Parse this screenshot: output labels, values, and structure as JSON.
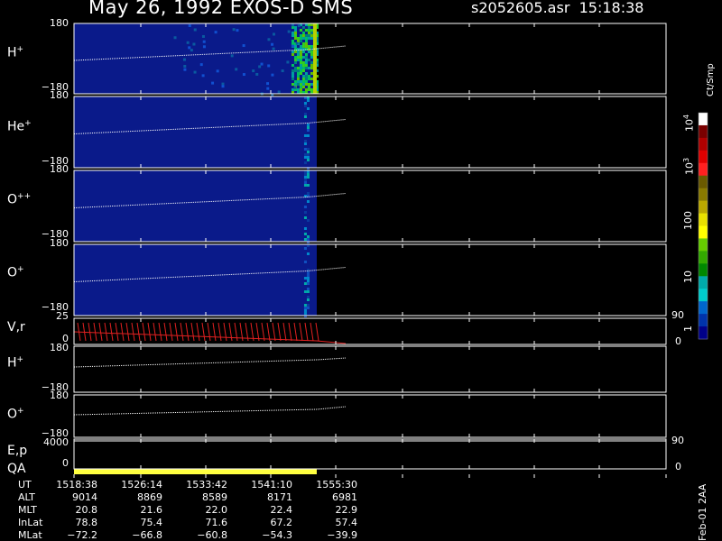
{
  "header": {
    "title": "May 26, 1992    EXOS-D SMS",
    "file": "s2052605.asr",
    "time": "15:18:38"
  },
  "panels": [
    {
      "label": "H",
      "sup": "+",
      "ticks": [
        "180",
        "−180"
      ]
    },
    {
      "label": "He",
      "sup": "+",
      "ticks": [
        "180",
        "−180"
      ]
    },
    {
      "label": "O",
      "sup": "++",
      "ticks": [
        "180",
        "−180"
      ]
    },
    {
      "label": "O",
      "sup": "+",
      "ticks": [
        "180",
        "−180"
      ]
    }
  ],
  "vr_panel": {
    "label": "V,r",
    "ticks": [
      "25",
      "0"
    ],
    "right_ticks": [
      "90",
      "0"
    ]
  },
  "lower_panels": [
    {
      "label": "H",
      "sup": "+",
      "ticks": [
        "180",
        "−180"
      ]
    },
    {
      "label": "O",
      "sup": "+",
      "ticks": [
        "180",
        "−180"
      ]
    }
  ],
  "ep_panel": {
    "label": "E,p",
    "ticks": [
      "4000",
      "0"
    ],
    "right_ticks": [
      "90",
      "0"
    ]
  },
  "qa_label": "QA",
  "colorbar": {
    "unit": "Ct/Smp",
    "labels": [
      "10",
      "10",
      "100",
      "10",
      "1"
    ],
    "exponents": [
      "4",
      "3",
      "",
      "",
      ""
    ],
    "colors": [
      "#ffffff",
      "#7a0000",
      "#b00000",
      "#e00000",
      "#ff2020",
      "#6b5a00",
      "#8a7a00",
      "#bba800",
      "#e8e000",
      "#ffff00",
      "#66cc00",
      "#33aa00",
      "#008800",
      "#00aaaa",
      "#00cccc",
      "#0066cc",
      "#0033aa",
      "#000088"
    ]
  },
  "ut_table": {
    "rows": [
      {
        "name": "UT",
        "values": [
          "1518:38",
          "1526:14",
          "1533:42",
          "1541:10",
          "1555:30"
        ]
      },
      {
        "name": "ALT",
        "values": [
          "9014",
          "8869",
          "8589",
          "8171",
          "6981"
        ]
      },
      {
        "name": "MLT",
        "values": [
          "20.8",
          "21.6",
          "22.0",
          "22.4",
          "22.9"
        ]
      },
      {
        "name": "InLat",
        "values": [
          "78.8",
          "75.4",
          "71.6",
          "67.2",
          "57.4"
        ]
      },
      {
        "name": "MLat",
        "values": [
          "−72.2",
          "−66.8",
          "−60.8",
          "−54.3",
          "−39.9"
        ]
      }
    ]
  },
  "footer": {
    "stamp": "Feb-01 2AA"
  },
  "chart_data": {
    "type": "heatmap",
    "title": "May 26, 1992    EXOS-D SMS",
    "x_ticks": [
      "1518:38",
      "1526:14",
      "1533:42",
      "1541:10",
      "1555:30"
    ],
    "data_end_fraction": 0.41,
    "panels": [
      "H+",
      "He+",
      "O++",
      "O+",
      "V,r",
      "H+",
      "O+",
      "E,p"
    ],
    "y_range_pitch": [
      -180,
      180
    ],
    "colorbar_range": [
      1,
      10000
    ],
    "colorbar_scale": "log",
    "grid": true
  }
}
